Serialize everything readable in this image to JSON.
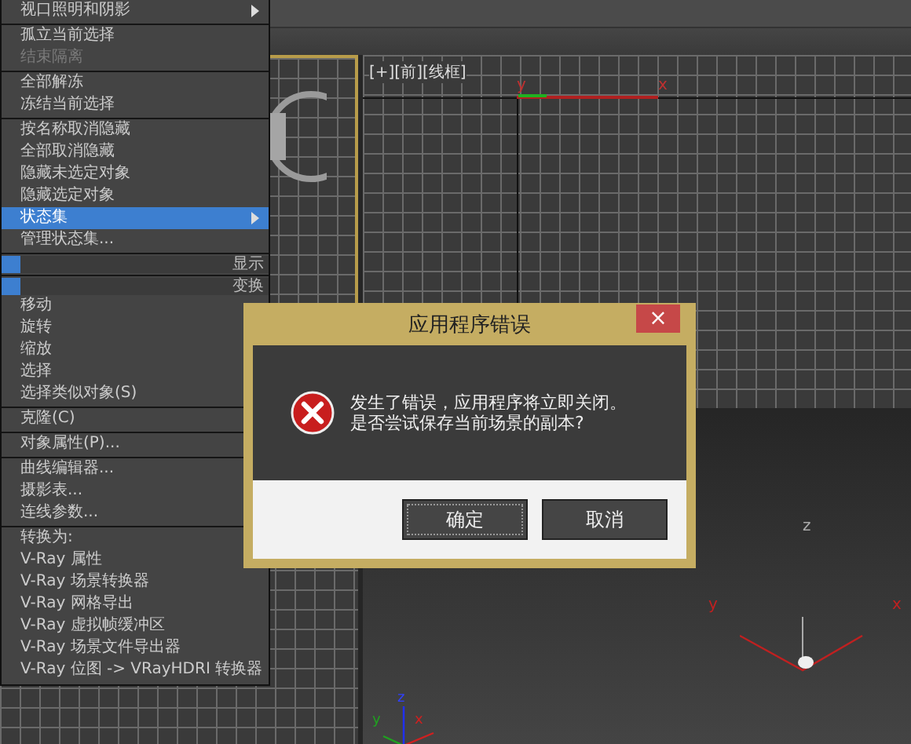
{
  "context_menu": {
    "items": [
      {
        "kind": "item",
        "label": "视口照明和阴影",
        "submenu": true,
        "disabled": false,
        "selected": false,
        "separator_before": false
      },
      {
        "kind": "item",
        "label": "孤立当前选择",
        "disabled": false,
        "selected": false,
        "separator_before": true
      },
      {
        "kind": "item",
        "label": "结束隔离",
        "disabled": true,
        "selected": false,
        "separator_before": false
      },
      {
        "kind": "item",
        "label": "全部解冻",
        "disabled": false,
        "selected": false,
        "separator_before": true
      },
      {
        "kind": "item",
        "label": "冻结当前选择",
        "disabled": false,
        "selected": false,
        "separator_before": false
      },
      {
        "kind": "item",
        "label": "按名称取消隐藏",
        "disabled": false,
        "selected": false,
        "separator_before": true
      },
      {
        "kind": "item",
        "label": "全部取消隐藏",
        "disabled": false,
        "selected": false,
        "separator_before": false
      },
      {
        "kind": "item",
        "label": "隐藏未选定对象",
        "disabled": false,
        "selected": false,
        "separator_before": false
      },
      {
        "kind": "item",
        "label": "隐藏选定对象",
        "disabled": false,
        "selected": false,
        "separator_before": false
      },
      {
        "kind": "item",
        "label": "状态集",
        "submenu": true,
        "disabled": false,
        "selected": true,
        "separator_before": false
      },
      {
        "kind": "item",
        "label": "管理状态集...",
        "disabled": false,
        "selected": false,
        "separator_before": false
      },
      {
        "kind": "header",
        "label": "显示"
      },
      {
        "kind": "header",
        "label": "变换"
      },
      {
        "kind": "item",
        "label": "移动",
        "disabled": false,
        "selected": false,
        "separator_before": false
      },
      {
        "kind": "item",
        "label": "旋转",
        "disabled": false,
        "selected": false,
        "separator_before": false
      },
      {
        "kind": "item",
        "label": "缩放",
        "disabled": false,
        "selected": false,
        "separator_before": false
      },
      {
        "kind": "item",
        "label": "选择",
        "disabled": false,
        "selected": false,
        "separator_before": false
      },
      {
        "kind": "item",
        "label": "选择类似对象(S)",
        "disabled": false,
        "selected": false,
        "separator_before": false
      },
      {
        "kind": "item",
        "label": "克隆(C)",
        "disabled": false,
        "selected": false,
        "separator_before": true
      },
      {
        "kind": "item",
        "label": "对象属性(P)...",
        "disabled": false,
        "selected": false,
        "separator_before": true
      },
      {
        "kind": "item",
        "label": "曲线编辑器...",
        "disabled": false,
        "selected": false,
        "separator_before": true
      },
      {
        "kind": "item",
        "label": "摄影表...",
        "disabled": false,
        "selected": false,
        "separator_before": false
      },
      {
        "kind": "item",
        "label": "连线参数...",
        "disabled": false,
        "selected": false,
        "separator_before": false
      },
      {
        "kind": "item",
        "label": "转换为:",
        "disabled": false,
        "selected": false,
        "separator_before": true
      },
      {
        "kind": "item",
        "label": "V-Ray 属性",
        "disabled": false,
        "selected": false,
        "separator_before": false
      },
      {
        "kind": "item",
        "label": "V-Ray 场景转换器",
        "disabled": false,
        "selected": false,
        "separator_before": false
      },
      {
        "kind": "item",
        "label": "V-Ray 网格导出",
        "disabled": false,
        "selected": false,
        "separator_before": false
      },
      {
        "kind": "item",
        "label": "V-Ray 虚拟帧缓冲区",
        "disabled": false,
        "selected": false,
        "separator_before": false
      },
      {
        "kind": "item",
        "label": "V-Ray 场景文件导出器",
        "disabled": false,
        "selected": false,
        "separator_before": false
      },
      {
        "kind": "item",
        "label": "V-Ray 位图 -> VRayHDRI 转换器",
        "disabled": false,
        "selected": false,
        "separator_before": false
      }
    ]
  },
  "viewports": {
    "front": {
      "label": "[+][前][线框]",
      "axis_y": "y",
      "axis_x": "x"
    },
    "perspective": {
      "axis_z": "z",
      "axis_y": "y",
      "axis_x": "x",
      "tripod_z": "z",
      "tripod_y": "y",
      "tripod_x": "x"
    }
  },
  "dialog": {
    "title": "应用程序错误",
    "close": "×",
    "message": [
      "发生了错误，应用程序将立即关闭。",
      "是否尝试保存当前场景的副本?"
    ],
    "buttons": [
      {
        "label": "确定",
        "focused": true
      },
      {
        "label": "取消",
        "focused": false
      }
    ]
  }
}
